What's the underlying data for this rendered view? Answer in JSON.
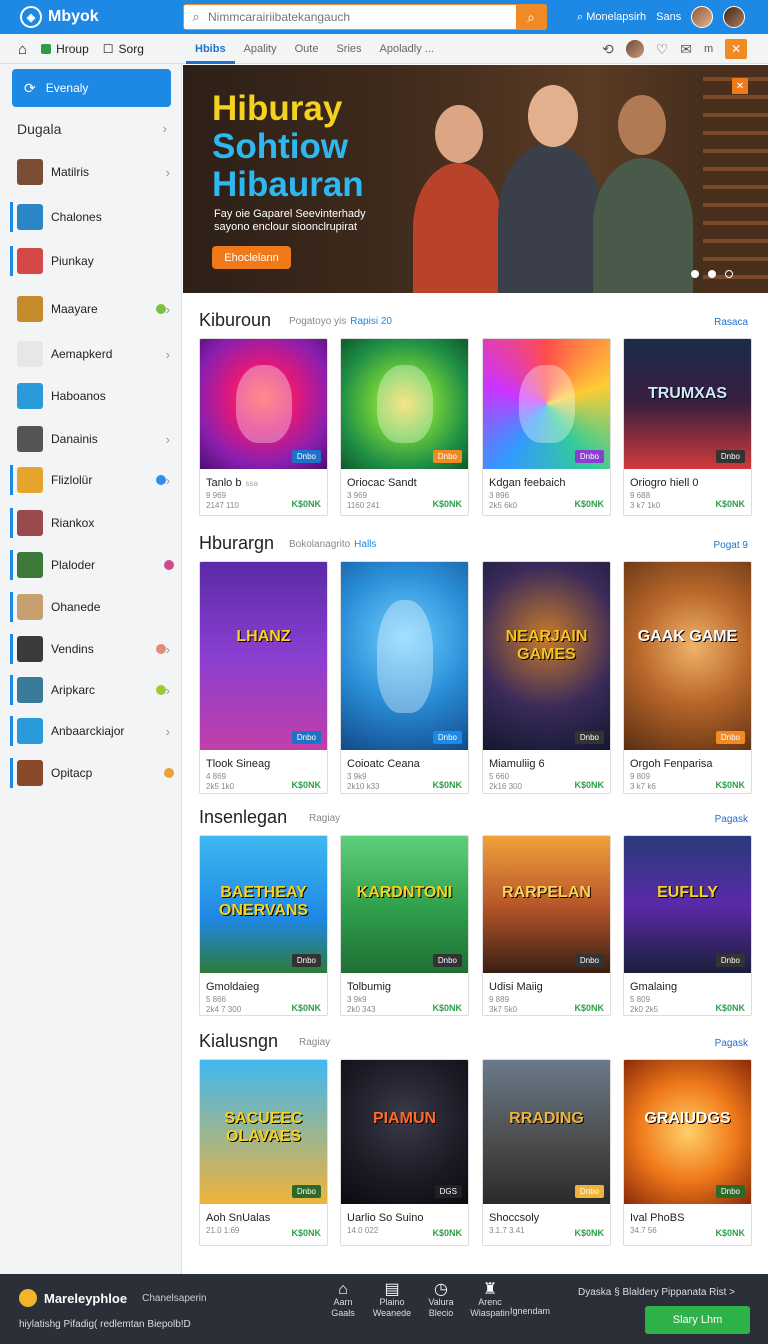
{
  "header": {
    "brand": "Mbyok",
    "search_placeholder": "Nimmcarairiibatekangauch",
    "right_label": "Monelapsirh",
    "right_label2": "Sans"
  },
  "subnav": {
    "home_icon": "home-icon",
    "item1": "Hroup",
    "item2": "Sorg",
    "tabs": [
      "Hbibs",
      "Apality",
      "Oute",
      "Sries",
      "Apoladly ..."
    ],
    "active_tab": 0
  },
  "sidebar": {
    "top_button": "Evenaly",
    "section": "Dugala",
    "items": [
      {
        "label": "Matilris",
        "color": "#7b4d35",
        "active": false,
        "chev": true,
        "dot": ""
      },
      {
        "label": "Chalones",
        "color": "#2b86c5",
        "active": true,
        "chev": false,
        "dot": ""
      },
      {
        "label": "Piunkay",
        "color": "#d44848",
        "active": true,
        "chev": false,
        "dot": ""
      },
      {
        "label": "Maayare",
        "color": "#c58a2a",
        "active": false,
        "chev": true,
        "dot": "#7cc242"
      },
      {
        "label": "Aemapkerd",
        "color": "#e7e7e7",
        "active": false,
        "chev": true,
        "dot": ""
      },
      {
        "label": "Haboanos",
        "color": "#2a9ad8",
        "active": false,
        "chev": false,
        "dot": ""
      },
      {
        "label": "Danainis",
        "color": "#555555",
        "active": false,
        "chev": true,
        "dot": ""
      },
      {
        "label": "Flizlolür",
        "color": "#e5a52d",
        "active": true,
        "chev": true,
        "dot": "#2d8fe5"
      },
      {
        "label": "Riankox",
        "color": "#9a4a4a",
        "active": true,
        "chev": false,
        "dot": ""
      },
      {
        "label": "Plaloder",
        "color": "#3d7a3a",
        "active": true,
        "chev": false,
        "dot": "#d04b8a"
      },
      {
        "label": "Ohanede",
        "color": "#c8a070",
        "active": true,
        "chev": false,
        "dot": ""
      },
      {
        "label": "Vendins",
        "color": "#3a3a3a",
        "active": true,
        "chev": true,
        "dot": "#e38a7a"
      },
      {
        "label": "Aripkarc",
        "color": "#3a7a9a",
        "active": true,
        "chev": true,
        "dot": "#9bc93a"
      },
      {
        "label": "Anbaarckiajor",
        "color": "#2a9ad8",
        "active": true,
        "chev": true,
        "dot": ""
      },
      {
        "label": "Opitacp",
        "color": "#8a4a2a",
        "active": true,
        "chev": false,
        "dot": "#e8a23a"
      }
    ]
  },
  "hero": {
    "line1": "Hiburay",
    "line2": "Sohtiow",
    "line3": "Hibauran",
    "subtitle": "Fay oie Gaparel Seevinterhady sayono enclour sioonclrupirat",
    "cta": "Ehoclelann"
  },
  "sections": [
    {
      "title": "Kiburoun",
      "subtitle": "Pogatoyo yis",
      "highlight": "Rapisi 20",
      "link": "Rasaca",
      "cards": [
        {
          "title": "Tanlo b",
          "extra": "ssa",
          "meta1": "9 969",
          "meta2": "2147 110",
          "price": "K$0NK",
          "badge": "Dnbo",
          "badge_color": "#1e73c9",
          "art_text": "",
          "bg": "radial-gradient(circle at 50% 45%,#ff4d4d 0%,#e0187a 35%,#8a1fb0 70%,#4a1070 100%)",
          "art_color": "#fff"
        },
        {
          "title": "Oriocac Sandt",
          "extra": "",
          "meta1": "3 969",
          "meta2": "1160 241",
          "price": "K$0NK",
          "badge": "Dnbo",
          "badge_color": "#f08a24",
          "art_text": "",
          "bg": "radial-gradient(circle at 50% 50%,#f3d64a 0%,#6bcb3a 35%,#1f8f45 70%,#0f5a2a 100%)",
          "art_color": "#fff"
        },
        {
          "title": "Kdgan feebaich",
          "extra": "",
          "meta1": "3 896",
          "meta2": "2k5 6k0",
          "price": "K$0NK",
          "badge": "Dnbo",
          "badge_color": "#8a3fd0",
          "art_text": "",
          "bg": "conic-gradient(from 0deg at 50% 50%,#ff4d4d,#ffcc33,#33cc99,#3399ff,#cc33ff,#ff4d4d)",
          "art_color": "#fff"
        },
        {
          "title": "Oriogro hiell 0",
          "extra": "",
          "meta1": "9 688",
          "meta2": "3 k7 1k0",
          "price": "K$0NK",
          "badge": "Dnbo",
          "badge_color": "#333",
          "art_text": "TRUMXAS",
          "bg": "linear-gradient(180deg,#1c2a4a 0%,#3a1f3f 50%,#d23a3a 100%)",
          "art_color": "#cfe6ff"
        }
      ]
    },
    {
      "title": "Hburargn",
      "subtitle": "Bokolanagrito",
      "highlight": "Halls",
      "link": "Pogat 9",
      "cards": [
        {
          "title": "Tlook Sineag",
          "extra": "",
          "meta1": "4 869",
          "meta2": "2k5 1k0",
          "price": "K$0NK",
          "badge": "Dnbo",
          "badge_color": "#1e73c9",
          "art_text": "LHANZ",
          "bg": "linear-gradient(180deg,#5a2aa8 0%,#8a3fd0 50%,#c23fa8 100%)",
          "art_color": "#f7d21f"
        },
        {
          "title": "Coioatc Ceana",
          "extra": "",
          "meta1": "3 9k9",
          "meta2": "2k10 k33",
          "price": "K$0NK",
          "badge": "Dnbo",
          "badge_color": "#1e88e5",
          "art_text": "",
          "bg": "radial-gradient(circle at 50% 40%,#6fd0ff 0%,#2a8fd8 50%,#124a8a 100%)",
          "art_color": "#fff"
        },
        {
          "title": "Miamuliig 6",
          "extra": "",
          "meta1": "5 660",
          "meta2": "2k16 300",
          "price": "K$0NK",
          "badge": "Dnbo",
          "badge_color": "#333",
          "art_text": "NEARJAIN GAMES",
          "bg": "radial-gradient(circle at 50% 40%,#c77b2a 0%,#3a2a5a 55%,#12182f 100%)",
          "art_color": "#f7c21f"
        },
        {
          "title": "Orgoh Fenparisa",
          "extra": "",
          "meta1": "9 809",
          "meta2": "3 k7 k6",
          "price": "K$0NK",
          "badge": "Dnbo",
          "badge_color": "#f08a24",
          "art_text": "GAAK GAME",
          "bg": "radial-gradient(circle at 55% 45%,#f0b36a 0%,#b8672a 45%,#5a2e12 100%)",
          "art_color": "#fff"
        }
      ]
    },
    {
      "title": "Insenlegan",
      "subtitle": "Ragiay",
      "highlight": "",
      "link": "Pagask",
      "cards": [
        {
          "title": "Gmoldaieg",
          "extra": "",
          "meta1": "5 866",
          "meta2": "2k4 7 300",
          "price": "K$0NK",
          "badge": "Dnbo",
          "badge_color": "#333",
          "art_text": "BAETHEAY ONERVANS",
          "bg": "linear-gradient(180deg,#3fb8f0 0%,#1e88e5 60%,#2d7a3a 100%)",
          "art_color": "#f7d21f"
        },
        {
          "title": "Tolbumig",
          "extra": "",
          "meta1": "3 9k9",
          "meta2": "2k0 343",
          "price": "K$0NK",
          "badge": "Dnbo",
          "badge_color": "#333",
          "art_text": "KARDNTONI",
          "bg": "linear-gradient(180deg,#5fd07a 0%,#2e9d4a 55%,#1f6f35 100%)",
          "art_color": "#f7d21f"
        },
        {
          "title": "Udisi Maiig",
          "extra": "",
          "meta1": "9 889",
          "meta2": "3k7 5k0",
          "price": "K$0NK",
          "badge": "Dnbo",
          "badge_color": "#333",
          "art_text": "RARPELAN",
          "bg": "linear-gradient(180deg,#f0a23a 0%,#b8572a 50%,#3a1f14 100%)",
          "art_color": "#ffd15a"
        },
        {
          "title": "Gmalaing",
          "extra": "",
          "meta1": "5 809",
          "meta2": "2k0 2k5",
          "price": "K$0NK",
          "badge": "Dnbo",
          "badge_color": "#333",
          "art_text": "EUFLLY",
          "bg": "linear-gradient(180deg,#2a3a7a 0%,#5a2aa8 50%,#1a1f3a 100%)",
          "art_color": "#f7d21f"
        }
      ]
    },
    {
      "title": "Kialusngn",
      "subtitle": "Ragiay",
      "highlight": "",
      "link": "Pagask",
      "cards": [
        {
          "title": "Aoh SnUalas",
          "extra": "",
          "meta1": "",
          "meta2": "21.0 1:69",
          "price": "K$0NK",
          "badge": "Dnbo",
          "badge_color": "#2d6a2a",
          "art_text": "SACUEEC OLAVAES",
          "bg": "linear-gradient(180deg,#3fb8f0 0%,#f0b33a 100%)",
          "art_color": "#f7d21f"
        },
        {
          "title": "Uarlio So Suino",
          "extra": "",
          "meta1": "",
          "meta2": "14.0 022",
          "price": "K$0NK",
          "badge": "DGS",
          "badge_color": "#222",
          "art_text": "PIAMUN",
          "bg": "radial-gradient(circle at 50% 40%,#3a3a4a 0%,#1a1a24 60%,#0a0a10 100%)",
          "art_color": "#ff6a2a"
        },
        {
          "title": "Shoccsoly",
          "extra": "",
          "meta1": "",
          "meta2": "3.1.7 3.41",
          "price": "K$0NK",
          "badge": "Dnbo",
          "badge_color": "#f0b33a",
          "art_text": "RRADING",
          "bg": "linear-gradient(180deg,#6a7a8a 0%,#4a4a4a 60%,#2a2a2a 100%)",
          "art_color": "#f0b33a"
        },
        {
          "title": "Ival PhoBS",
          "extra": "",
          "meta1": "",
          "meta2": "34.7 56",
          "price": "K$0NK",
          "badge": "Dnbo",
          "badge_color": "#2d6a2a",
          "art_text": "GRAIUDGS",
          "bg": "radial-gradient(circle at 50% 50%,#ffd06a 0%,#f07a1a 50%,#8a2a0a 100%)",
          "art_color": "#fff"
        }
      ]
    }
  ],
  "footer": {
    "brand": "Mareleyphloe",
    "brand_small": "Chanelsaperin",
    "line2": "hiylatishg Pifadig( redlemtan Biepolb!D",
    "nav": [
      {
        "icon": "⌂",
        "name": "home",
        "l1": "Aarn",
        "l2": "Gaals"
      },
      {
        "icon": "▤",
        "name": "store",
        "l1": "Plaino",
        "l2": "Weanede"
      },
      {
        "icon": "◷",
        "name": "history",
        "l1": "Valura",
        "l2": "Blecio"
      },
      {
        "icon": "♜",
        "name": "awards",
        "l1": "Arenc",
        "l2": "Wiaspatin"
      }
    ],
    "nav_extra": "Ignendam",
    "right_text": "Dyaska §  Blaldery Pippanata Rist >",
    "play_button": "Slary Lhm"
  }
}
